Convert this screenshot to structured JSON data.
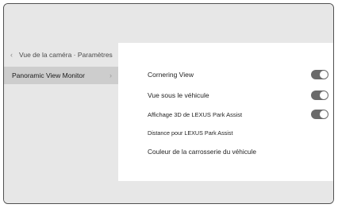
{
  "nav": {
    "back_label": "Vue de la caméra · Paramètres",
    "back_icon": "chevron-left-icon",
    "selected_item": {
      "label": "Panoramic View Monitor",
      "icon": "chevron-right-icon"
    }
  },
  "settings": [
    {
      "label": "Cornering View",
      "toggle": true,
      "state": "on"
    },
    {
      "label": "Vue sous le véhicule",
      "toggle": true,
      "state": "on"
    },
    {
      "label": "Affichage 3D de LEXUS Park Assist",
      "toggle": true,
      "state": "on"
    },
    {
      "label": "Distance pour LEXUS Park Assist",
      "toggle": false
    },
    {
      "label": "Couleur de la carrosserie du véhicule",
      "toggle": false
    }
  ],
  "colors": {
    "background": "#e7e7e7",
    "panel": "#ffffff",
    "selected": "#cdcdcd",
    "toggle_on": "#6a6a6a"
  }
}
